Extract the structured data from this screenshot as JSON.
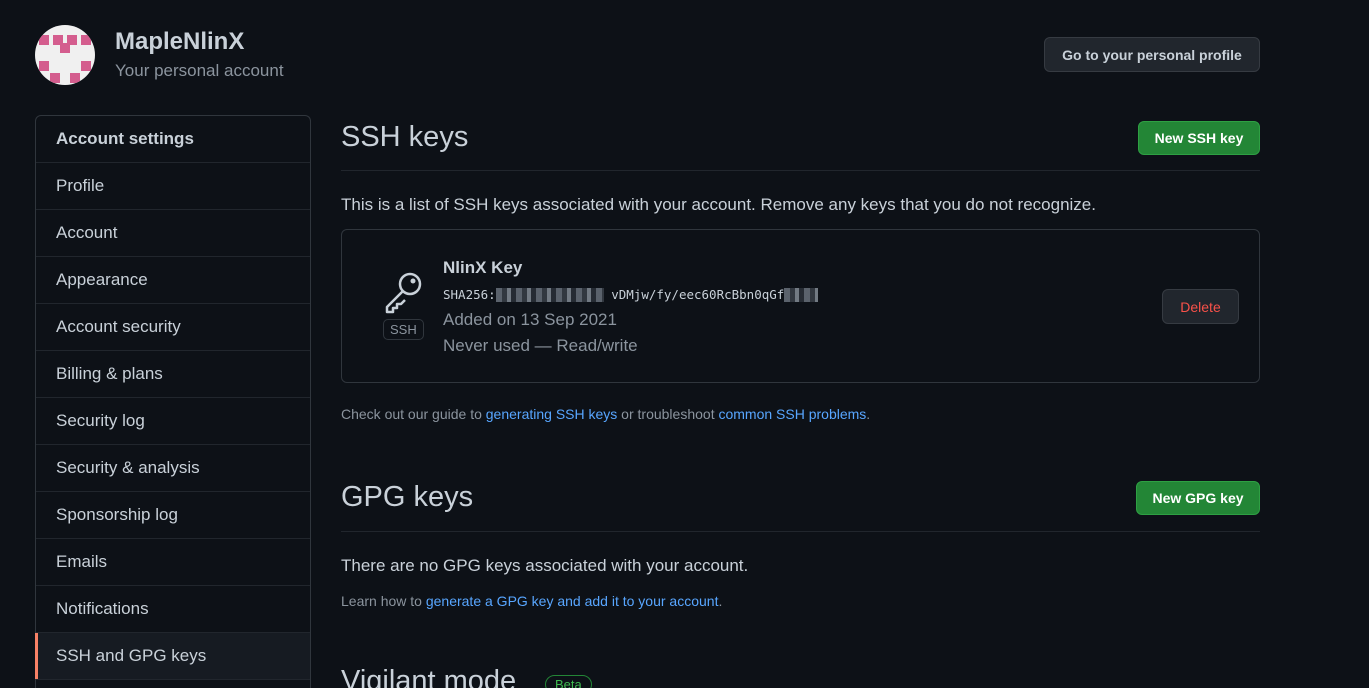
{
  "header": {
    "username": "MapleNlinX",
    "subtitle": "Your personal account",
    "profile_button": "Go to your personal profile"
  },
  "sidebar": {
    "items": [
      {
        "label": "Account settings"
      },
      {
        "label": "Profile"
      },
      {
        "label": "Account"
      },
      {
        "label": "Appearance"
      },
      {
        "label": "Account security"
      },
      {
        "label": "Billing & plans"
      },
      {
        "label": "Security log"
      },
      {
        "label": "Security & analysis"
      },
      {
        "label": "Sponsorship log"
      },
      {
        "label": "Emails"
      },
      {
        "label": "Notifications"
      },
      {
        "label": "SSH and GPG keys"
      }
    ],
    "selected": "SSH and GPG keys"
  },
  "ssh": {
    "title": "SSH keys",
    "new_button": "New SSH key",
    "description": "This is a list of SSH keys associated with your account. Remove any keys that you do not recognize.",
    "key": {
      "name": "NlinX Key",
      "fingerprint_prefix": "SHA256:",
      "fingerprint_visible": "vDMjw/fy/eec60RcBbn0qGf",
      "type_label": "SSH",
      "added": "Added on 13 Sep 2021",
      "usage": "Never used — Read/write",
      "delete_label": "Delete"
    },
    "guide": {
      "prefix": "Check out our guide to ",
      "link1": "generating SSH keys",
      "middle": " or troubleshoot ",
      "link2": "common SSH problems",
      "suffix": "."
    }
  },
  "gpg": {
    "title": "GPG keys",
    "new_button": "New GPG key",
    "empty": "There are no GPG keys associated with your account.",
    "learn": {
      "prefix": "Learn how to ",
      "link": "generate a GPG key and add it to your account",
      "suffix": "."
    }
  },
  "vigilant": {
    "title": "Vigilant mode",
    "badge": "Beta"
  },
  "colors": {
    "background": "#0d1117",
    "primary_green": "#238636",
    "link_blue": "#58a6ff",
    "danger_red": "#f85149",
    "selected_accent": "#f78166"
  }
}
